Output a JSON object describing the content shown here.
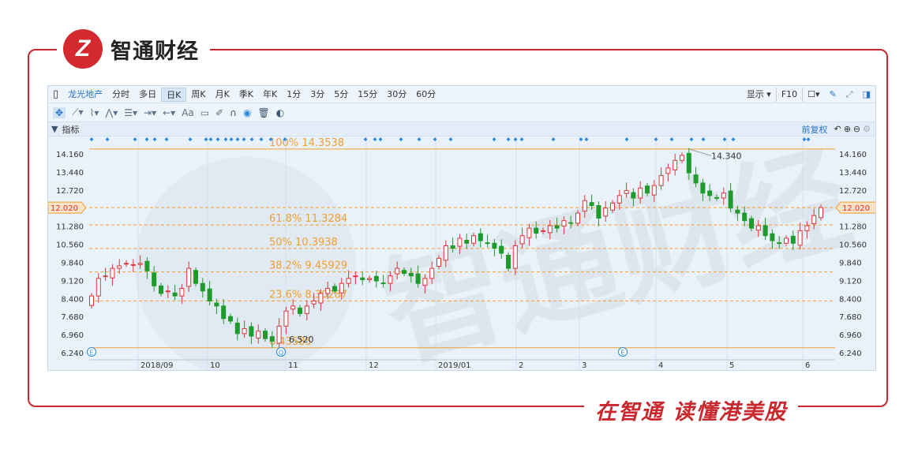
{
  "brand": {
    "name": "智通财经",
    "logo_letter": "Z",
    "slogan": "在智通  读懂港美股"
  },
  "toolbar": {
    "stock": "龙光地产",
    "periods": [
      "分时",
      "多日",
      "日K",
      "周K",
      "月K",
      "季K",
      "年K",
      "1分",
      "3分",
      "5分",
      "15分",
      "30分",
      "60分"
    ],
    "selected_period": "日K",
    "display": "显示",
    "f10": "F10",
    "text_tool": "Aa"
  },
  "indicator_bar": {
    "label": "指标",
    "adjust": "前复权"
  },
  "chart_data": {
    "type": "candlestick",
    "title": "龙光地产 日K",
    "ylim": [
      6.0,
      14.6
    ],
    "y_ticks": [
      "14.160",
      "13.440",
      "12.720",
      "11.280",
      "10.560",
      "9.840",
      "9.120",
      "8.400",
      "7.680",
      "6.960",
      "6.240"
    ],
    "current_price": "12.020",
    "x_ticks": [
      "2018/09",
      "10",
      "11",
      "12",
      "2019/01",
      "2",
      "3",
      "4",
      "5",
      "6"
    ],
    "closes": [
      8.5,
      9.2,
      9.3,
      9.6,
      9.7,
      9.8,
      9.75,
      9.8,
      9.5,
      8.9,
      8.6,
      8.7,
      8.5,
      8.8,
      9.6,
      9.0,
      8.7,
      8.3,
      8.1,
      7.6,
      7.5,
      7.0,
      7.2,
      6.9,
      7.1,
      6.8,
      6.7,
      7.3,
      7.9,
      8.1,
      7.8,
      8.1,
      8.3,
      8.6,
      8.8,
      8.7,
      9.0,
      9.2,
      9.3,
      9.15,
      9.2,
      9.1,
      9.0,
      9.3,
      9.6,
      9.4,
      9.3,
      9.0,
      9.2,
      9.6,
      10.0,
      10.5,
      10.4,
      10.8,
      10.6,
      10.9,
      10.7,
      10.6,
      10.4,
      10.2,
      9.6,
      10.5,
      10.9,
      11.2,
      11.0,
      11.1,
      11.3,
      11.2,
      11.5,
      11.4,
      11.8,
      12.3,
      12.1,
      11.6,
      12.0,
      12.2,
      12.5,
      12.7,
      12.4,
      12.8,
      12.6,
      12.9,
      13.3,
      13.6,
      13.9,
      14.1,
      13.4,
      13.0,
      12.6,
      12.5,
      12.4,
      12.6,
      12.0,
      11.8,
      11.5,
      11.2,
      11.3,
      10.9,
      10.7,
      10.6,
      10.8,
      10.6,
      11.1,
      11.3,
      11.7,
      12.02
    ],
    "fibonacci": [
      {
        "label": "100% 14.3538",
        "value": 14.3538,
        "style": "solid"
      },
      {
        "label": "61.8% 11.3284",
        "value": 11.3284,
        "style": "dashed"
      },
      {
        "label": "50% 10.3938",
        "value": 10.3938,
        "style": "dashed"
      },
      {
        "label": "38.2% 9.45929",
        "value": 9.45929,
        "style": "dashed"
      },
      {
        "label": "23.6% 8.30287",
        "value": 8.30287,
        "style": "dashed"
      },
      {
        "label": "6.43585",
        "value": 6.43585,
        "style": "solid"
      }
    ],
    "annotations": [
      {
        "label": "14.340",
        "value": 14.34
      },
      {
        "label": "6.520",
        "value": 6.52
      }
    ],
    "event_markers": [
      "E",
      "Q",
      "E"
    ],
    "colors": {
      "up": "#e0353b",
      "down": "#1f9a2c",
      "fib": "#f0a030",
      "axis": "#333333"
    }
  }
}
